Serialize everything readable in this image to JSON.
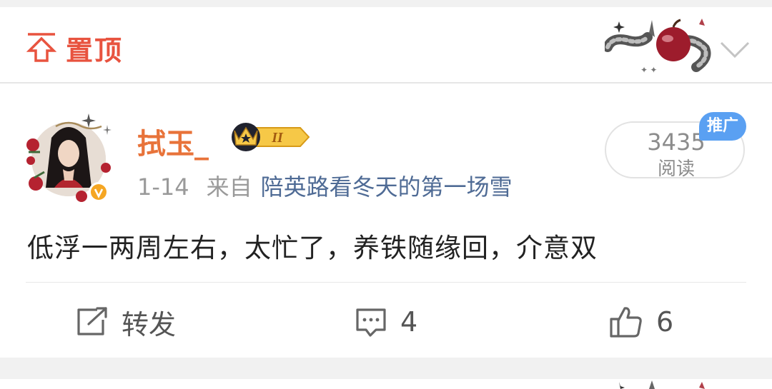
{
  "pin": {
    "label": "置顶"
  },
  "post": {
    "username": "拭玉_",
    "vip_level": "II",
    "date": "1-14",
    "source_prefix": "来自",
    "source": "陪英路看冬天的第一场雪",
    "reads": {
      "count": "3435",
      "label": "阅读"
    },
    "promo_badge": "推广",
    "content": "低浮一两周左右，太忙了，养铁随缘回，介意双",
    "actions": {
      "repost": {
        "label": "转发",
        "icon": "share-square-icon"
      },
      "comment": {
        "count": "4",
        "icon": "comment-icon"
      },
      "like": {
        "count": "6",
        "icon": "thumbs-up-icon"
      }
    }
  },
  "colors": {
    "pin_accent": "#e8533f",
    "username": "#e8733a",
    "source_link": "#4f6b95",
    "promo_badge": "#5aa0f2",
    "verified_badge": "#f5a623"
  }
}
